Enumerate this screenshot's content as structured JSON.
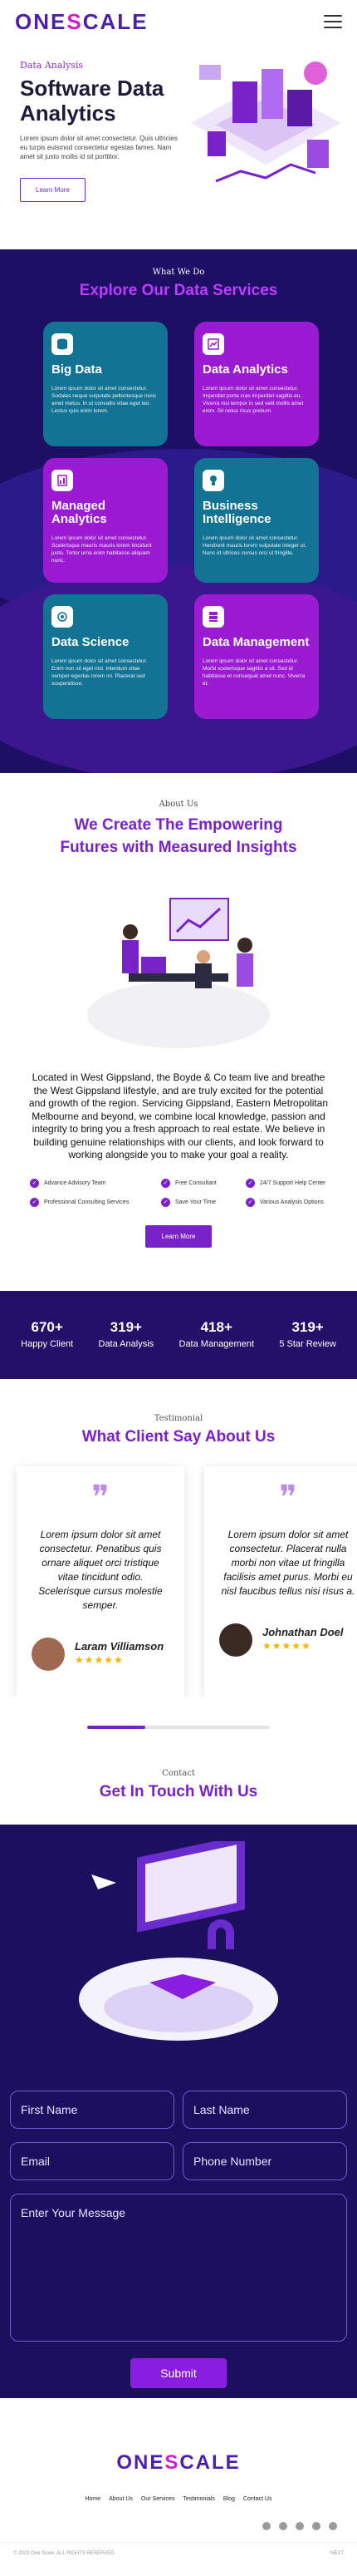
{
  "brand": {
    "logo_pre": "ONE",
    "logo_o": "S",
    "logo_post": "CALE",
    "accent": "#7a22c9",
    "pink": "#d21ec9",
    "navy": "#1d0f63"
  },
  "hero": {
    "eyebrow": "Data Analysis",
    "title": "Software Data Analytics",
    "text": "Lorem ipsum dolor sit amet consectetur. Quis ultricies eu turpis euismod consectetur egestas fames. Nam amet sit justo mollis id sit porttitor.",
    "cta": "Learn More"
  },
  "services": {
    "eyebrow": "What We Do",
    "title": "Explore Our Data Services",
    "items": [
      {
        "title": "Big Data",
        "icon": "database-icon",
        "text": "Lorem ipsum dolor sit amet consectetur. Sodales neque vulputate pellentesque nunc amet metus. In ut convallis vitae eget leo. Lectus quis enim lorem."
      },
      {
        "title": "Data Analytics",
        "icon": "chart-icon",
        "text": "Lorem ipsum dolor sit amet consectetur. Imperdiet porta cras imperdiet sagittis eu. Viverra nisi tempor in sed velit mollis amet enim. Sit netus risus pretium."
      },
      {
        "title": "Managed Analytics",
        "icon": "analytics-icon",
        "text": "Lorem ipsum dolor sit amet consectetur. Scelerisque mauris mauris lorem tincidunt justo. Tortor urna enim habitasse aliquam nunc."
      },
      {
        "title": "Business Intelligence",
        "icon": "bulb-icon",
        "text": "Lorem ipsum dolor sit amet consectetur. Hendrerit mauris lorem vulputate integer ut. Nunc et ultrices cursus orci ut fringilla."
      },
      {
        "title": "Data Science",
        "icon": "science-icon",
        "text": "Lorem ipsum dolor sit amet consectetur. Enim non sit eget nisl. Interdum vitae semper egestas lorem mi. Placerat sed suspendisse."
      },
      {
        "title": "Data Management",
        "icon": "server-icon",
        "text": "Lorem ipsum dolor sit amet consectetur. Morbi scelerisque sagittis a sit. Sed id habitasse et consequat amet nunc. Viverra et."
      }
    ]
  },
  "about": {
    "eyebrow": "About Us",
    "title": "We Create The Empowering Futures with Measured Insights",
    "text": "Located in West Gippsland, the Boyde & Co team live and breathe the West Gippsland lifestyle, and are truly excited for the potential and growth of the region. Servicing Gippsland, Eastern Metropolitan Melbourne and beyond, we combine local knowledge, passion and integrity to bring you a fresh approach to real estate. We believe in building genuine relationships with our clients, and look forward to working alongside you to make your goal a reality.",
    "features": [
      "Advance Advisory Team",
      "Free Consultant",
      "24/7 Support Help Center",
      "Professional Consulting Services",
      "Save Your Time",
      "Various Analysis Options"
    ],
    "cta": "Learn More"
  },
  "stats": [
    {
      "value": "670+",
      "label": "Happy Client"
    },
    {
      "value": "319+",
      "label": "Data Analysis"
    },
    {
      "value": "418+",
      "label": "Data Management"
    },
    {
      "value": "319+",
      "label": "5 Star Review"
    }
  ],
  "testimonials": {
    "eyebrow": "Testimonial",
    "title": "What Client Say About Us",
    "items": [
      {
        "text": "Lorem ipsum dolor sit amet consectetur. Penatibus quis ornare aliquet orci tristique vitae tincidunt odio. Scelerisque cursus molestie semper.",
        "name": "Laram Villiamson",
        "stars": "★★★★★",
        "avatar": "#a06a52"
      },
      {
        "text": "Lorem ipsum dolor sit amet consectetur. Placerat nulla morbi non vitae ut fringilla facilisis amet purus. Morbi eu nisl faucibus tellus nisi risus a.",
        "name": "Johnathan Doel",
        "stars": "★★★★★",
        "avatar": "#3a2a24"
      }
    ]
  },
  "contact": {
    "eyebrow": "Contact",
    "title": "Get In Touch With Us",
    "first_name": "First Name",
    "last_name": "Last Name",
    "email": "Email",
    "phone": "Phone Number",
    "message": "Enter Your Message",
    "submit": "Submit"
  },
  "footer": {
    "nav": [
      "Home",
      "About Us",
      "Our Services",
      "Testimonials",
      "Blog",
      "Contact Us"
    ],
    "social": [
      "facebook-icon",
      "instagram-icon",
      "pinterest-icon",
      "twitter-icon",
      "linkedin-icon"
    ],
    "copyright": "© 2022 One Scale, ALL RIGHTS RESERVED.",
    "next": "NEXT"
  }
}
